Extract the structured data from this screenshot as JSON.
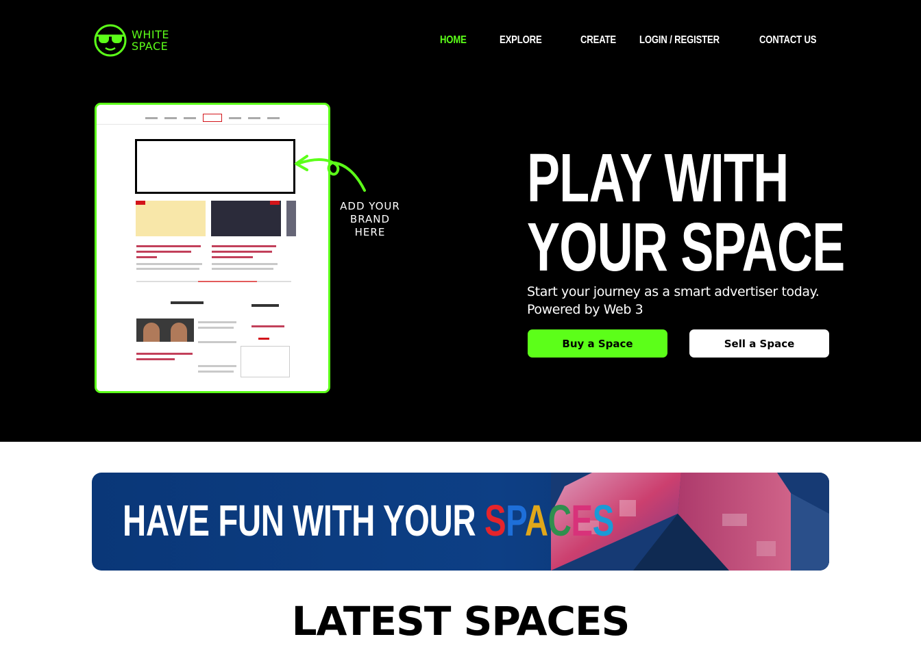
{
  "brand": {
    "line1": "WHITE",
    "line2": "SPACE",
    "accent": "#5cff19",
    "icon": "sunglasses-face-icon"
  },
  "nav": {
    "items": [
      {
        "label": "HOME",
        "active": true
      },
      {
        "label": "EXPLORE",
        "active": false
      },
      {
        "label": "CREATE",
        "active": false
      },
      {
        "label": "LOGIN / REGISTER",
        "active": false
      },
      {
        "label": "CONTACT US",
        "active": false
      }
    ]
  },
  "hero": {
    "preview_note": {
      "line1": "ADD YOUR",
      "line2": "BRAND",
      "line3": "HERE"
    },
    "headline": {
      "line1": "PLAY WITH",
      "line2": "YOUR SPACE"
    },
    "subtitle": {
      "line1": "Start your journey as a smart advertiser today.",
      "line2": "Powered by Web 3"
    },
    "buy_label": "Buy a Space",
    "sell_label": "Sell a Space"
  },
  "banner": {
    "prefix": "HAVE FUN WITH YOUR ",
    "word_letters": [
      "S",
      "P",
      "A",
      "C",
      "E",
      "S"
    ],
    "word_colors": [
      "#e5242b",
      "#1e6fd9",
      "#e0a71a",
      "#2f8f4e",
      "#d8327a",
      "#1a9ad6"
    ]
  },
  "latest": {
    "title": "LATEST SPACES"
  }
}
